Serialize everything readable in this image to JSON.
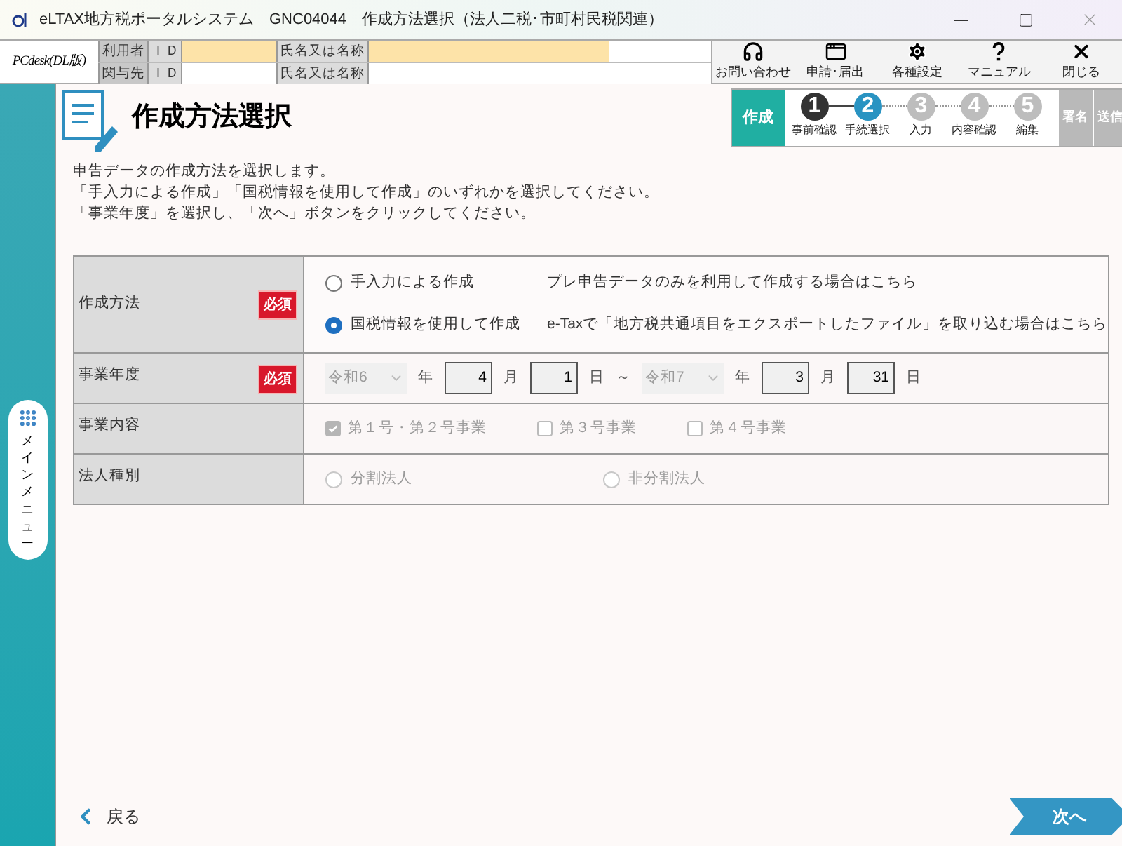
{
  "window": {
    "title": "eLTAX地方税ポータルシステム　GNC04044　作成方法選択（法人二税･市町村民税関連）"
  },
  "header": {
    "logo": "PCdesk(DL版)",
    "rows": [
      {
        "role": "利用者",
        "id_label": "ＩＤ",
        "id_value_filled": true,
        "name_label": "氏名又は名称",
        "name_value_filled": true
      },
      {
        "role": "関与先",
        "id_label": "ＩＤ",
        "id_value_filled": false,
        "name_label": "氏名又は名称",
        "name_value_filled": false
      }
    ],
    "tools": [
      {
        "kind": "headset",
        "label": "お問い合わせ"
      },
      {
        "kind": "window",
        "label": "申請･届出"
      },
      {
        "kind": "gear",
        "label": "各種設定"
      },
      {
        "kind": "help",
        "label": "マニュアル"
      },
      {
        "kind": "close",
        "label": "閉じる"
      }
    ]
  },
  "side_menu": {
    "label": "メインメニュー"
  },
  "page": {
    "title": "作成方法選択",
    "instructions": [
      "申告データの作成方法を選択します。",
      "「手入力による作成」「国税情報を使用して作成」のいずれかを選択してください。",
      "「事業年度」を選択し、「次へ」ボタンをクリックしてください。"
    ]
  },
  "stage_tabs": [
    {
      "label": "作成",
      "selected": true,
      "steps": [
        {
          "number": "1",
          "label": "事前確認",
          "completed": true,
          "selected": false
        },
        {
          "number": "2",
          "label": "手続選択",
          "completed": false,
          "selected": true
        },
        {
          "number": "3",
          "label": "入力",
          "completed": false,
          "selected": false
        },
        {
          "number": "4",
          "label": "内容確認",
          "completed": false,
          "selected": false
        },
        {
          "number": "5",
          "label": "編集",
          "selected": false
        }
      ]
    },
    {
      "label": "署名",
      "selected": false
    },
    {
      "label": "送信",
      "selected": false
    }
  ],
  "form": [
    {
      "kind": "radio",
      "label": "作成方法",
      "required": "必須",
      "disabled": false,
      "options": [
        {
          "label": "手入力による作成",
          "description": "プレ申告データのみを利用して作成する場合はこちら",
          "selected": false
        },
        {
          "label": "国税情報を使用して作成",
          "description": "e-Taxで「地方税共通項目をエクスポートしたファイル」を取り込む場合はこちら",
          "selected": true
        }
      ]
    },
    {
      "kind": "date",
      "label": "事業年度",
      "required": "必須",
      "disabled": true,
      "separator": "～",
      "ranges": [
        {
          "era": "令和6",
          "year_unit": "年",
          "month": "4",
          "month_unit": "月",
          "day": "1",
          "day_unit": "日"
        },
        {
          "era": "令和7",
          "year_unit": "年",
          "month": "3",
          "month_unit": "月",
          "day": "31",
          "day_unit": "日"
        }
      ]
    },
    {
      "kind": "checkbox",
      "label": "事業内容",
      "disabled": true,
      "options": [
        {
          "label": "第１号・第２号事業",
          "checked": true
        },
        {
          "label": "第３号事業",
          "checked": false
        },
        {
          "label": "第４号事業",
          "checked": false
        }
      ]
    },
    {
      "kind": "radio",
      "label": "法人種別",
      "disabled": true,
      "options": [
        {
          "label": "分割法人",
          "selected": false
        },
        {
          "label": "非分割法人",
          "selected": false
        }
      ]
    }
  ],
  "footer": {
    "back": "戻る",
    "next": "次へ"
  }
}
